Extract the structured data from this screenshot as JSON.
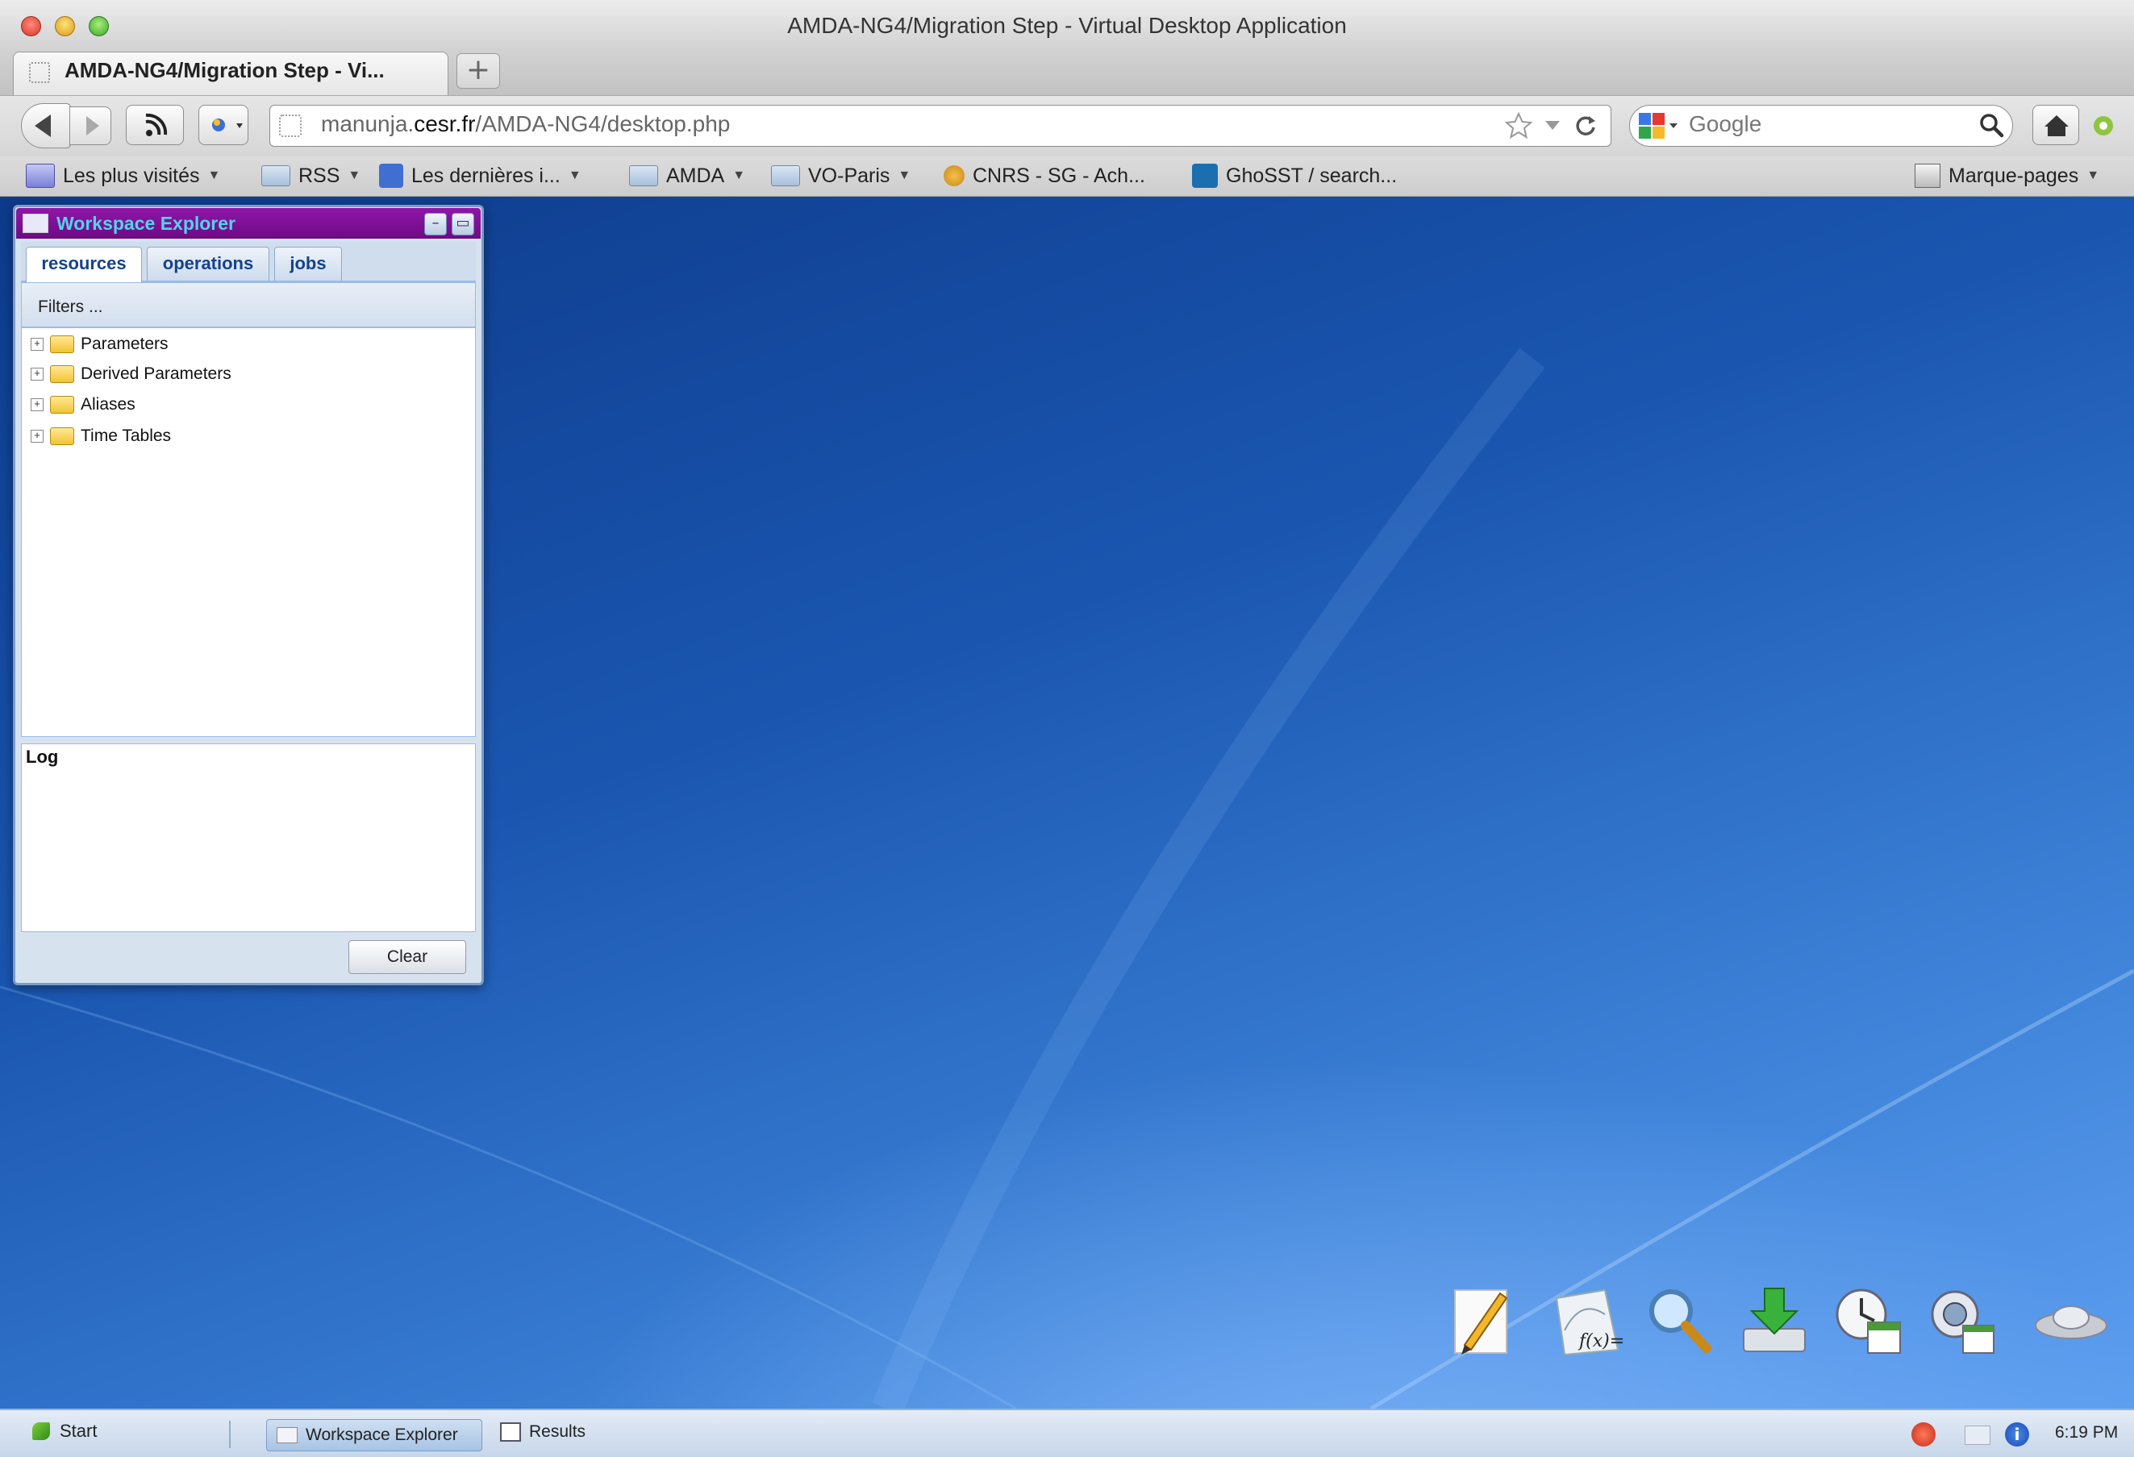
{
  "window": {
    "title": "AMDA-NG4/Migration Step - Virtual Desktop Application"
  },
  "tab": {
    "title": "AMDA-NG4/Migration Step - Vi..."
  },
  "toolbar": {
    "url_host_prefix": "manunja.",
    "url_host_domain": "cesr.fr",
    "url_path": "/AMDA-NG4/desktop.php",
    "search_placeholder": "Google"
  },
  "bookmarks": [
    {
      "label": "Les plus visités",
      "icon": "most-visited-icon"
    },
    {
      "label": "RSS",
      "icon": "folder-icon"
    },
    {
      "label": "Les dernières i...",
      "icon": "rss-feed-icon"
    },
    {
      "label": "AMDA",
      "icon": "folder-icon"
    },
    {
      "label": "VO-Paris",
      "icon": "folder-icon"
    },
    {
      "label": "CNRS - SG - Ach...",
      "icon": "cnrs-icon"
    },
    {
      "label": "GhoSST / search...",
      "icon": "ghosst-icon"
    },
    {
      "label": "Marque-pages",
      "icon": "bookmarks-menu-icon"
    }
  ],
  "workspace_explorer": {
    "title": "Workspace Explorer",
    "tabs": [
      "resources",
      "operations",
      "jobs"
    ],
    "active_tab": "resources",
    "filters_label": "Filters ...",
    "tree": [
      "Parameters",
      "Derived Parameters",
      "Aliases",
      "Time Tables"
    ],
    "log_title": "Log",
    "clear_label": "Clear"
  },
  "desktop_icons": [
    "notes-icon",
    "function-icon",
    "search-icon",
    "download-icon",
    "timetable-icon",
    "settings-icon",
    "interop-icon"
  ],
  "taskbar": {
    "start_label": "Start",
    "items": [
      "Workspace Explorer",
      "Results"
    ],
    "clock": "6:19 PM"
  },
  "colors": {
    "window_header": "#7a0d92",
    "window_title": "#4fd6e8",
    "desktop_top": "#0d3a8a",
    "desktop_bottom": "#5d9ef0"
  }
}
